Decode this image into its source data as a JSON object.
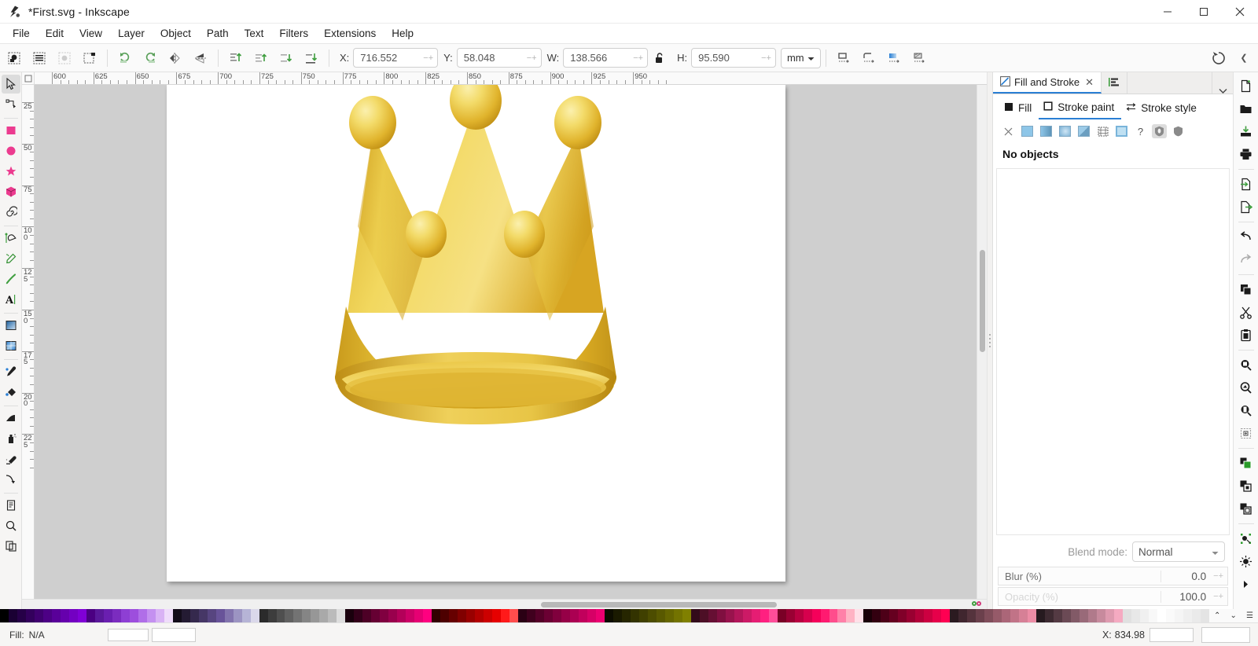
{
  "window": {
    "title": "*First.svg - Inkscape",
    "app_icon": "inkscape-logo-icon",
    "controls": {
      "minimize": "—",
      "maximize": "□",
      "close": "✕"
    }
  },
  "menubar": {
    "items": [
      "File",
      "Edit",
      "View",
      "Layer",
      "Object",
      "Path",
      "Text",
      "Filters",
      "Extensions",
      "Help"
    ]
  },
  "toolbar": {
    "select_buttons": [
      {
        "name": "select-all-icon",
        "tip": "Select all objects"
      },
      {
        "name": "select-all-in-layers-icon",
        "tip": "Select all in all layers"
      },
      {
        "name": "deselect-icon",
        "tip": "Deselect"
      },
      {
        "name": "toggle-selection-box-icon",
        "tip": "Toggle selection box"
      }
    ],
    "transform_buttons": [
      {
        "name": "rotate-ccw-icon",
        "tip": "Rotate 90 counter-clockwise"
      },
      {
        "name": "rotate-cw-icon",
        "tip": "Rotate 90 clockwise"
      },
      {
        "name": "flip-horizontal-icon",
        "tip": "Flip horizontal"
      },
      {
        "name": "flip-vertical-icon",
        "tip": "Flip vertical"
      }
    ],
    "zorder_buttons": [
      {
        "name": "raise-to-top-icon",
        "tip": "Raise to top"
      },
      {
        "name": "raise-icon",
        "tip": "Raise"
      },
      {
        "name": "lower-icon",
        "tip": "Lower"
      },
      {
        "name": "lower-to-bottom-icon",
        "tip": "Lower to bottom"
      }
    ],
    "fields": [
      {
        "label": "X:",
        "value": "716.552",
        "name": "x-position-input"
      },
      {
        "label": "Y:",
        "value": "58.048",
        "name": "y-position-input"
      },
      {
        "label": "W:",
        "value": "138.566",
        "name": "width-input"
      },
      {
        "label": "H:",
        "value": "95.590",
        "name": "height-input"
      }
    ],
    "lock_icon": "unlocked-padlock-icon",
    "units": {
      "value": "mm",
      "name": "units-select"
    },
    "affect_buttons": [
      {
        "name": "affect-stroke-width-icon"
      },
      {
        "name": "affect-rounded-corners-icon"
      },
      {
        "name": "affect-gradients-icon"
      },
      {
        "name": "affect-patterns-icon"
      }
    ],
    "dock_toggle": "snap-toolbar-toggle-icon",
    "collapse": "❮"
  },
  "toolbox": {
    "tools": [
      {
        "name": "selector-tool",
        "icon": "arrow-cursor-icon",
        "active": true
      },
      {
        "name": "node-tool",
        "icon": "node-editor-icon",
        "active": false
      },
      {
        "name": "rectangle-tool",
        "icon": "rectangle-icon",
        "active": false
      },
      {
        "name": "ellipse-tool",
        "icon": "ellipse-icon",
        "active": false
      },
      {
        "name": "star-tool",
        "icon": "star-icon",
        "active": false
      },
      {
        "name": "box3d-tool",
        "icon": "cube-3d-icon",
        "active": false
      },
      {
        "name": "spiral-tool",
        "icon": "spiral-icon",
        "active": false
      },
      {
        "name": "pen-tool",
        "icon": "bezier-pen-icon",
        "active": false
      },
      {
        "name": "pencil-tool",
        "icon": "pencil-icon",
        "active": false
      },
      {
        "name": "calligraphy-tool",
        "icon": "calligraphy-brush-icon",
        "active": false
      },
      {
        "name": "text-tool",
        "icon": "text-a-icon",
        "active": false
      },
      {
        "name": "gradient-tool",
        "icon": "gradient-square-icon",
        "active": false
      },
      {
        "name": "mesh-tool",
        "icon": "mesh-gradient-icon",
        "active": false
      },
      {
        "name": "dropper-tool",
        "icon": "eyedropper-icon",
        "active": false
      },
      {
        "name": "paintbucket-tool",
        "icon": "paint-bucket-icon",
        "active": false
      },
      {
        "name": "tweak-tool",
        "icon": "tweak-icon",
        "active": false
      },
      {
        "name": "spray-tool",
        "icon": "spray-can-icon",
        "active": false
      },
      {
        "name": "eraser-tool",
        "icon": "eraser-icon",
        "active": false
      },
      {
        "name": "connector-tool",
        "icon": "connector-arrow-icon",
        "active": false
      },
      {
        "name": "pages-tool",
        "icon": "page-icon",
        "active": false
      },
      {
        "name": "zoom-tool",
        "icon": "magnifier-icon",
        "active": false
      },
      {
        "name": "measure-tool",
        "icon": "measure-icon",
        "active": false
      }
    ]
  },
  "rulers": {
    "horizontal": {
      "labels": [
        "600",
        "625",
        "650",
        "675",
        "700",
        "725",
        "750",
        "775",
        "800",
        "825",
        "850",
        "875",
        "900",
        "925",
        "950"
      ],
      "start": 600,
      "step": 25
    },
    "vertical": {
      "labels": [
        "25",
        "50",
        "75",
        "100",
        "125",
        "150",
        "175",
        "200",
        "225"
      ]
    }
  },
  "canvas": {
    "artwork_name": "golden-crown-illustration",
    "artwork_description": "Golden crown with five points topped by gold spheres",
    "colors": {
      "gold_light": "#F7E07A",
      "gold_mid": "#F0CE4B",
      "gold_dark": "#D6A61E",
      "gold_shadow": "#B88915",
      "page_background": "#FFFFFF",
      "canvas_background": "#CFCFCF"
    }
  },
  "dock": {
    "tabs": [
      {
        "label": "Fill and Stroke",
        "icon": "fill-stroke-icon",
        "active": true,
        "closable": true
      },
      {
        "label": "",
        "icon": "objects-list-icon",
        "active": false,
        "closable": false
      }
    ],
    "chevron": "⌄",
    "fill_stroke": {
      "tabs": [
        {
          "label": "Fill",
          "icon": "filled-square-icon",
          "active": false
        },
        {
          "label": "Stroke paint",
          "icon": "outlined-square-icon",
          "active": true
        },
        {
          "label": "Stroke style",
          "icon": "stroke-style-icon",
          "active": false
        }
      ],
      "paint_types": [
        {
          "name": "no-paint-button",
          "icon": "x-icon",
          "selected": false
        },
        {
          "name": "flat-color-button",
          "icon": "flat-color-swatch",
          "selected": false
        },
        {
          "name": "linear-gradient-button",
          "icon": "linear-gradient-swatch",
          "selected": false
        },
        {
          "name": "radial-gradient-button",
          "icon": "radial-gradient-swatch",
          "selected": false
        },
        {
          "name": "pattern-button",
          "icon": "pattern-swatch",
          "selected": false
        },
        {
          "name": "swatch-button",
          "icon": "swatch-grid-icon",
          "selected": false
        },
        {
          "name": "swatch-color-button",
          "icon": "swatch-color-icon",
          "selected": false
        },
        {
          "name": "unknown-paint-button",
          "icon": "question-mark-icon",
          "selected": false
        },
        {
          "name": "fill-rule-evenodd-button",
          "icon": "evenodd-shield-icon",
          "selected": true
        },
        {
          "name": "fill-rule-nonzero-button",
          "icon": "nonzero-shield-icon",
          "selected": false
        }
      ],
      "status_message": "No objects",
      "blend_mode": {
        "label": "Blend mode:",
        "value": "Normal"
      },
      "blur": {
        "label": "Blur (%)",
        "value": "0.0"
      },
      "opacity": {
        "label": "Opacity (%)",
        "value": "100.0"
      }
    }
  },
  "commandbar": {
    "buttons": [
      {
        "name": "new-document-button",
        "icon": "new-file-icon",
        "disabled": false
      },
      {
        "name": "open-document-button",
        "icon": "open-folder-icon",
        "disabled": false
      },
      {
        "name": "save-document-button",
        "icon": "save-disk-icon",
        "disabled": false
      },
      {
        "name": "print-button",
        "icon": "printer-icon",
        "disabled": false
      },
      {
        "name": "import-button",
        "icon": "import-icon",
        "disabled": false
      },
      {
        "name": "export-button",
        "icon": "export-icon",
        "disabled": false
      },
      {
        "name": "undo-button",
        "icon": "undo-arrow-icon",
        "disabled": false
      },
      {
        "name": "redo-button",
        "icon": "redo-arrow-icon",
        "disabled": true
      },
      {
        "name": "copy-button",
        "icon": "copy-icon",
        "disabled": false
      },
      {
        "name": "cut-button",
        "icon": "scissors-icon",
        "disabled": false
      },
      {
        "name": "paste-button",
        "icon": "clipboard-icon",
        "disabled": false
      },
      {
        "name": "zoom-selection-button",
        "icon": "zoom-selection-icon",
        "disabled": false
      },
      {
        "name": "zoom-drawing-button",
        "icon": "zoom-drawing-icon",
        "disabled": false
      },
      {
        "name": "zoom-page-button",
        "icon": "zoom-page-icon",
        "disabled": false
      },
      {
        "name": "duplicate-button",
        "icon": "duplicate-icon",
        "disabled": false
      },
      {
        "name": "group-button",
        "icon": "group-icon",
        "disabled": false
      },
      {
        "name": "ungroup-button",
        "icon": "ungroup-icon",
        "disabled": false
      },
      {
        "name": "clone-button",
        "icon": "clone-icon",
        "disabled": false
      },
      {
        "name": "node-align-button",
        "icon": "node-align-icon",
        "disabled": false
      },
      {
        "name": "object-properties-button",
        "icon": "object-props-icon",
        "disabled": false
      },
      {
        "name": "xml-editor-button",
        "icon": "xml-triangle-icon",
        "disabled": false
      }
    ]
  },
  "statusbar": {
    "fill_label": "Fill:",
    "fill_value": "N/A",
    "coord_label": "X:",
    "coord_value": "834.98",
    "palette_up": "⌃",
    "palette_down": "⌄",
    "palette_menu": "☰"
  },
  "palette": {
    "colors": [
      "#000000",
      "#1a0033",
      "#260047",
      "#33005c",
      "#400070",
      "#4d0085",
      "#590099",
      "#6600ad",
      "#7300c2",
      "#8000d6",
      "#4b0082",
      "#5a189a",
      "#6a1fb0",
      "#7b2cbf",
      "#8e3fd4",
      "#9d4edd",
      "#b06ee8",
      "#c490f0",
      "#d9b3f5",
      "#efdcfb",
      "#130d1a",
      "#241b33",
      "#35294d",
      "#463766",
      "#574580",
      "#685399",
      "#8273ad",
      "#9c94c2",
      "#b6b4d6",
      "#dad8ea",
      "#2b2b2b",
      "#3d3d3d",
      "#4f4f4f",
      "#616161",
      "#737373",
      "#858585",
      "#979797",
      "#a9a9a9",
      "#bbbbbb",
      "#dddddd",
      "#1a000d",
      "#33001a",
      "#4d0026",
      "#660033",
      "#800040",
      "#99004d",
      "#b30059",
      "#cc0066",
      "#e60073",
      "#ff0080",
      "#330000",
      "#4d0000",
      "#660000",
      "#800000",
      "#990000",
      "#b30000",
      "#cc0000",
      "#e60000",
      "#ff1a1a",
      "#ff4d4d",
      "#2b0014",
      "#40001e",
      "#550028",
      "#6b0033",
      "#80003d",
      "#960047",
      "#ab0052",
      "#c1005c",
      "#d60066",
      "#ec0071",
      "#0d0d00",
      "#1a1a00",
      "#262600",
      "#333300",
      "#404000",
      "#4d4d00",
      "#595900",
      "#666600",
      "#737300",
      "#808000",
      "#330a1a",
      "#4d0f26",
      "#660f33",
      "#800f40",
      "#99134d",
      "#b3165a",
      "#cc1a66",
      "#e61d73",
      "#ff2080",
      "#ff4d99",
      "#7a0026",
      "#990033",
      "#b80040",
      "#d6004d",
      "#f5005a",
      "#ff1a70",
      "#ff4d8c",
      "#ff80a8",
      "#ffb3c4",
      "#ffe0e8",
      "#1a0008",
      "#330010",
      "#4d0018",
      "#660020",
      "#800029",
      "#990031",
      "#b30039",
      "#cc0041",
      "#e6004a",
      "#ff0052",
      "#2b1a20",
      "#40262f",
      "#55333d",
      "#6b404c",
      "#804d5a",
      "#965a69",
      "#ab6678",
      "#c17387",
      "#d68096",
      "#ec8ca5",
      "#261a1f",
      "#3d2a31",
      "#543a43",
      "#6b4a55",
      "#825a67",
      "#996a79",
      "#b07a8b",
      "#c78a9d",
      "#de9aaf",
      "#f5aac1",
      "#e0e0e0",
      "#e8e8e8",
      "#f0f0f0",
      "#f8f8f8",
      "#ffffff",
      "#fafafa",
      "#f5f5f5",
      "#efefef",
      "#eaeaea",
      "#e4e4e4"
    ]
  }
}
